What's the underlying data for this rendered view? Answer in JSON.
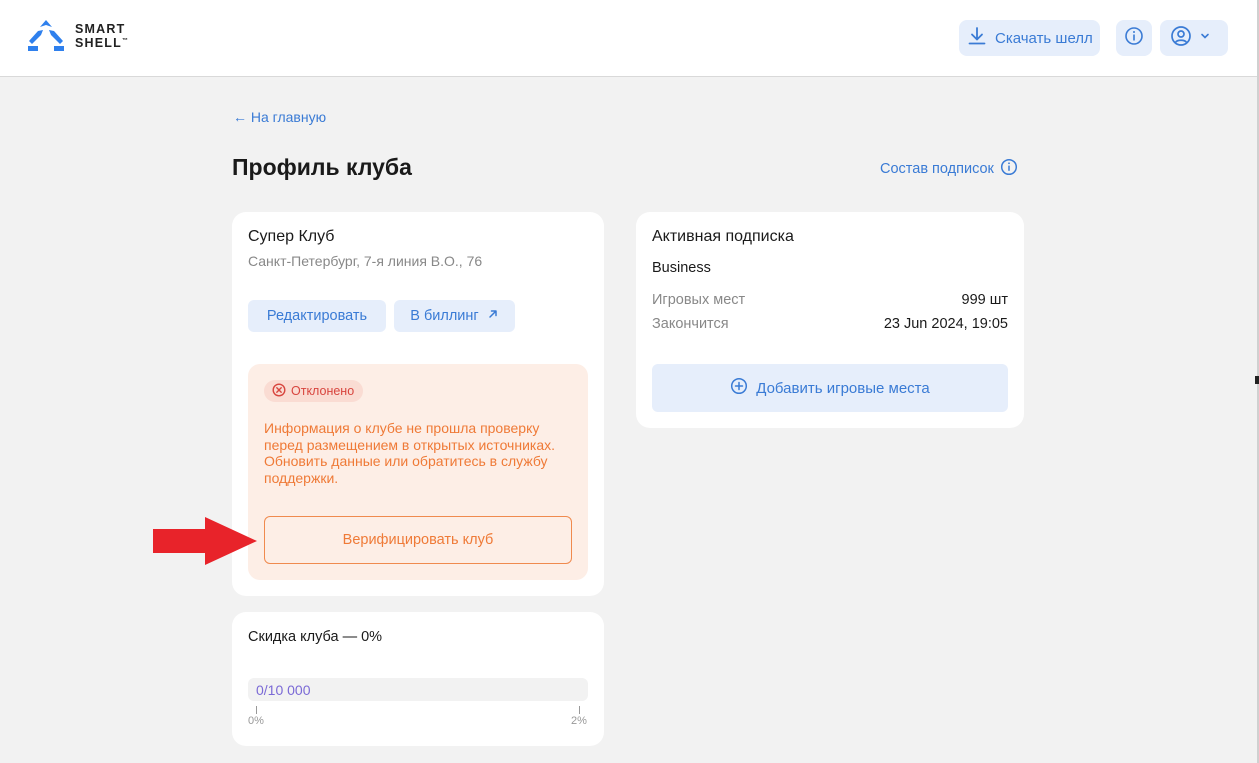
{
  "header": {
    "logo_line1": "SMART",
    "logo_line2": "SHELL",
    "logo_tm": "™",
    "download_label": "Скачать шелл"
  },
  "page": {
    "back_link": "← На главную",
    "title": "Профиль клуба",
    "subscriptions_link": "Состав подписок"
  },
  "club": {
    "name": "Супер Клуб",
    "address": "Санкт-Петербург, 7-я линия В.О., 76",
    "edit_label": "Редактировать",
    "billing_label": "В биллинг",
    "status_badge": "Отклонено",
    "warning_text": "Информация о клубе не прошла проверку перед размещением в открытых источниках. Обновить данные или обратитесь в службу поддержки.",
    "verify_label": "Верифицировать клуб"
  },
  "subscription": {
    "title": "Активная подписка",
    "plan": "Business",
    "rows": [
      {
        "label": "Игровых мест",
        "value": "999 шт"
      },
      {
        "label": "Закончится",
        "value": "23 Jun 2024, 19:05"
      }
    ],
    "add_label": "Добавить игровые места"
  },
  "discount": {
    "title": "Скидка клуба — 0%",
    "progress_text": "0/10 000",
    "progress_fraction": 0,
    "tick_min": "0%",
    "tick_max": "2%"
  },
  "colors": {
    "accent": "#3a7bd5",
    "warning": "#ef7a37",
    "danger": "#d8453e",
    "arrow": "#e8232a"
  }
}
